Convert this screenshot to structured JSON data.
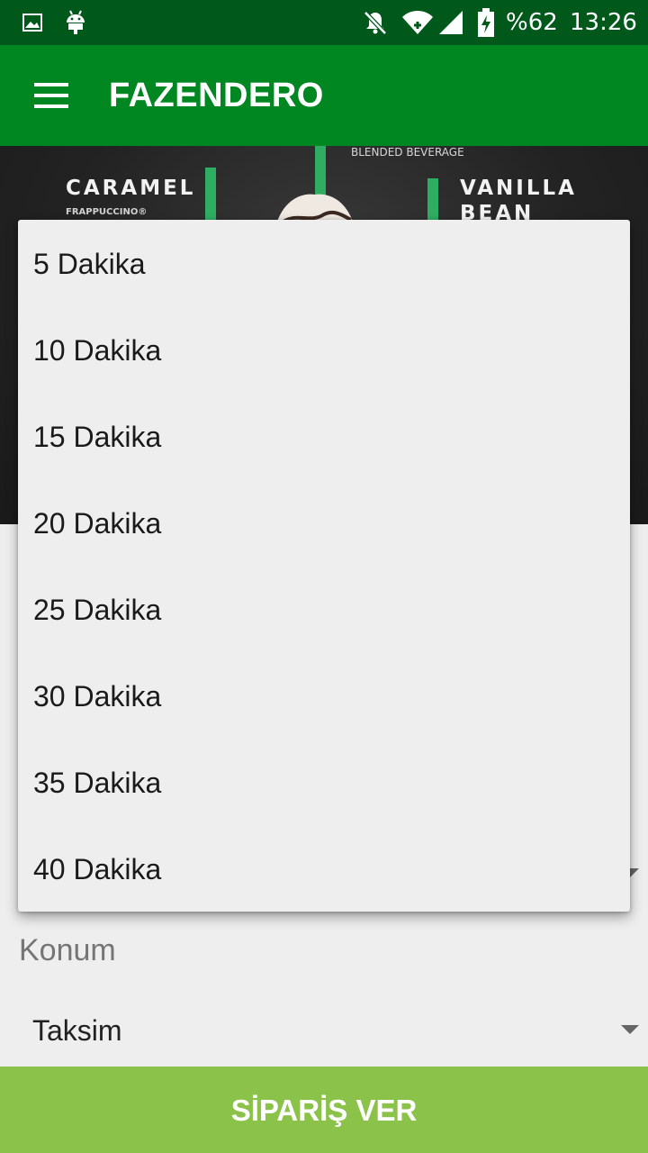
{
  "status_bar": {
    "battery": "%62",
    "time": "13:26",
    "icons": [
      "image-icon",
      "android-icon",
      "notifications-off-icon",
      "wifi-icon",
      "signal-icon",
      "battery-charging-icon"
    ]
  },
  "app_bar": {
    "title": "FAZENDERO",
    "menu_icon": "hamburger-menu-icon"
  },
  "hero": {
    "left_name": "CARAMEL",
    "left_sub": "FRAPPUCCINO®",
    "center_text": "BLENDED BEVERAGE",
    "right_name_line1": "VANILLA",
    "right_name_line2": "BEAN"
  },
  "dropdown": {
    "options": [
      "5 Dakika",
      "10 Dakika",
      "15 Dakika",
      "20 Dakika",
      "25 Dakika",
      "30 Dakika",
      "35 Dakika",
      "40 Dakika"
    ]
  },
  "form": {
    "location_label": "Konum",
    "location_value": "Taksim"
  },
  "order_button": {
    "label": "SİPARİŞ VER"
  },
  "colors": {
    "status_bar": "#00591a",
    "app_bar": "#008722",
    "order_button": "#8bc34a",
    "background": "#eeeeee"
  }
}
